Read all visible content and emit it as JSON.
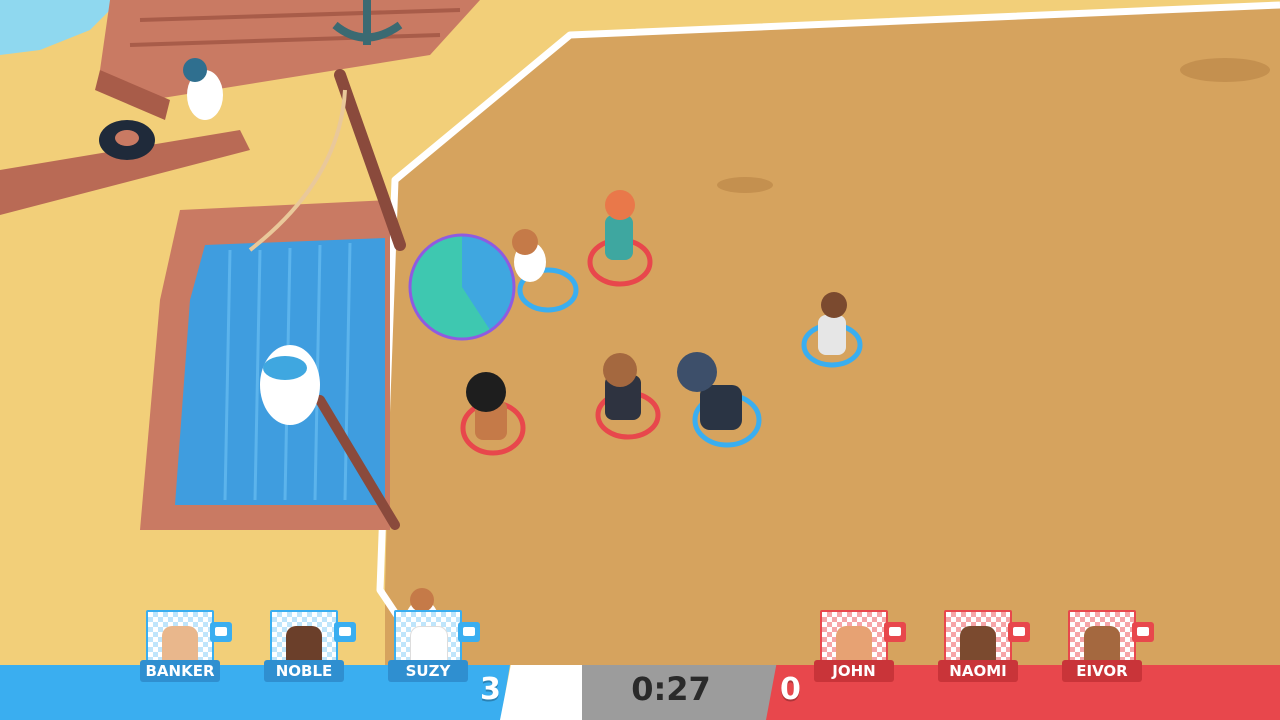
{
  "match": {
    "blue_score": "3",
    "red_score": "0",
    "timer": "0:27"
  },
  "blue_team": [
    {
      "name": "BANKER",
      "skin": "#e9b78c",
      "hair": "#3a2a20"
    },
    {
      "name": "NOBLE",
      "skin": "#6b3f2a",
      "hair": "#1e2233"
    },
    {
      "name": "SUZY",
      "skin": "#ffffff",
      "hair": "#c57a48"
    }
  ],
  "red_team": [
    {
      "name": "JOHN",
      "skin": "#e7a273",
      "hair": "#d8d8d8"
    },
    {
      "name": "NAOMI",
      "skin": "#7b4a2f",
      "hair": "#1c1c1c"
    },
    {
      "name": "EIVOR",
      "skin": "#a4683f",
      "hair": "#4a3a2a"
    }
  ],
  "colors": {
    "blue_team": "#3aaef0",
    "red_team": "#e8474c",
    "timer_bg": "#9c9c9c",
    "sand": "#f2cf79",
    "arena": "#d6a35e",
    "water": "#3f9ddf",
    "wood": "#c97a63"
  }
}
